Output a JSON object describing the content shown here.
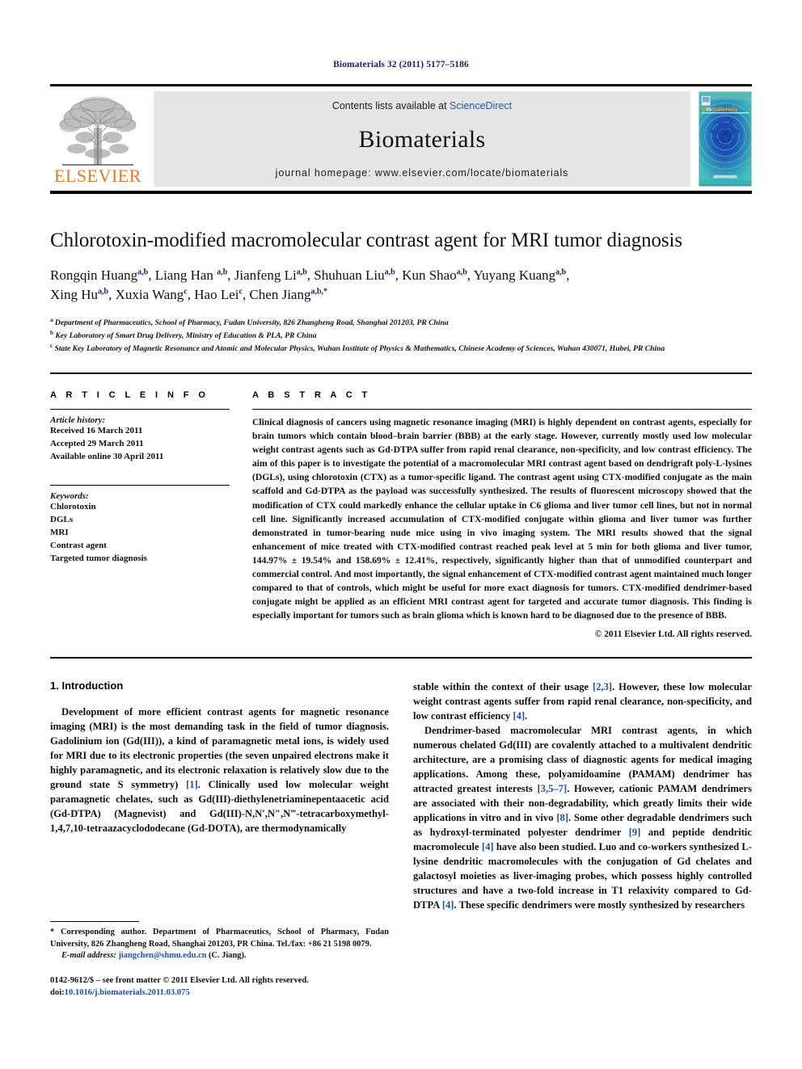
{
  "running_head": "Biomaterials 32 (2011) 5177–5186",
  "banner": {
    "publisher": "ELSEVIER",
    "contents_prefix": "Contents lists available at ",
    "contents_link": "ScienceDirect",
    "journal_name": "Biomaterials",
    "homepage": "journal homepage: www.elsevier.com/locate/biomaterials",
    "cover_title": "Biomaterials"
  },
  "article": {
    "title": "Chlorotoxin-modified macromolecular contrast agent for MRI tumor diagnosis",
    "authors_line1": "Rongqin Huang a,b, Liang Han a,b, Jianfeng Li a,b, Shuhuan Liu a,b, Kun Shao a,b, Yuyang Kuang a,b,",
    "authors_line2": "Xing Hu a,b, Xuxia Wang c, Hao Lei c, Chen Jiang a,b,*",
    "affiliations": [
      "Department of Pharmaceutics, School of Pharmacy, Fudan University, 826 Zhangheng Road, Shanghai 201203, PR China",
      "Key Laboratory of Smart Drug Delivery, Ministry of Education & PLA, PR China",
      "State Key Laboratory of Magnetic Resonance and Atomic and Molecular Physics, Wuhan Institute of Physics & Mathematics, Chinese Academy of Sciences, Wuhan 430071, Hubei, PR China"
    ]
  },
  "article_info": {
    "heading": "A R T I C L E   I N F O",
    "history_label": "Article history:",
    "history": [
      "Received 16 March 2011",
      "Accepted 29 March 2011",
      "Available online 30 April 2011"
    ],
    "keywords_label": "Keywords:",
    "keywords": [
      "Chlorotoxin",
      "DGLs",
      "MRI",
      "Contrast agent",
      "Targeted tumor diagnosis"
    ]
  },
  "abstract": {
    "heading": "A B S T R A C T",
    "text": "Clinical diagnosis of cancers using magnetic resonance imaging (MRI) is highly dependent on contrast agents, especially for brain tumors which contain blood–brain barrier (BBB) at the early stage. However, currently mostly used low molecular weight contrast agents such as Gd-DTPA suffer from rapid renal clearance, non-specificity, and low contrast efficiency. The aim of this paper is to investigate the potential of a macromolecular MRI contrast agent based on dendrigraft poly-L-lysines (DGLs), using chlorotoxin (CTX) as a tumor-specific ligand. The contrast agent using CTX-modified conjugate as the main scaffold and Gd-DTPA as the payload was successfully synthesized. The results of fluorescent microscopy showed that the modification of CTX could markedly enhance the cellular uptake in C6 glioma and liver tumor cell lines, but not in normal cell line. Significantly increased accumulation of CTX-modified conjugate within glioma and liver tumor was further demonstrated in tumor-bearing nude mice using in vivo imaging system. The MRI results showed that the signal enhancement of mice treated with CTX-modified contrast reached peak level at 5 min for both glioma and liver tumor, 144.97% ± 19.54% and 158.69% ± 12.41%, respectively, significantly higher than that of unmodified counterpart and commercial control. And most importantly, the signal enhancement of CTX-modified contrast agent maintained much longer compared to that of controls, which might be useful for more exact diagnosis for tumors. CTX-modified dendrimer-based conjugate might be applied as an efficient MRI contrast agent for targeted and accurate tumor diagnosis. This finding is especially important for tumors such as brain glioma which is known hard to be diagnosed due to the presence of BBB.",
    "copyright": "© 2011 Elsevier Ltd. All rights reserved."
  },
  "introduction": {
    "heading": "1.  Introduction",
    "para1_a": "Development of more efficient contrast agents for magnetic resonance imaging (MRI) is the most demanding task in the field of tumor diagnosis. Gadolinium ion (Gd(III)), a kind of paramagnetic metal ions, is widely used for MRI due to its electronic properties (the seven unpaired electrons make it highly paramagnetic, and its electronic relaxation is relatively slow due to the ground state S symmetry) ",
    "ref1": "[1]",
    "para1_b": ". Clinically used low molecular weight paramagnetic chelates, such as Gd(III)-diethylenetriaminepentaacetic acid (Gd-DTPA) (Magnevist) and Gd(III)-N,N′,N″,N‴-tetracarboxymethyl-1,4,7,10-tetraazacyclododecane (Gd-DOTA), are thermodynamically ",
    "para1_c": "stable within the context of their usage ",
    "ref23": "[2,3]",
    "para1_d": ". However, these low molecular weight contrast agents suffer from rapid renal clearance, non-specificity, and low contrast efficiency ",
    "ref4": "[4]",
    "para1_e": ".",
    "para2_a": "Dendrimer-based macromolecular MRI contrast agents, in which numerous chelated Gd(III) are covalently attached to a multivalent dendritic architecture, are a promising class of diagnostic agents for medical imaging applications. Among these, polyamidoamine (PAMAM) dendrimer has attracted greatest interests ",
    "ref357": "[3,5–7]",
    "para2_b": ". However, cationic PAMAM dendrimers are associated with their non-degradability, which greatly limits their wide applications in vitro and in vivo ",
    "ref8": "[8]",
    "para2_c": ". Some other degradable dendrimers such as hydroxyl-terminated polyester dendrimer ",
    "ref9": "[9]",
    "para2_d": " and peptide dendritic macromolecule ",
    "ref4b": "[4]",
    "para2_e": " have also been studied. Luo and co-workers synthesized L-lysine dendritic macromolecules with the conjugation of Gd chelates and galactosyl moieties as liver-imaging probes, which possess highly controlled structures and have a two-fold increase in T1 relaxivity compared to Gd-DTPA ",
    "ref4c": "[4]",
    "para2_f": ". These specific dendrimers were mostly synthesized by researchers"
  },
  "footnote": {
    "corresponding": "* Corresponding author. Department of Pharmaceutics, School of Pharmacy, Fudan University, 826 Zhangheng Road, Shanghai 201203, PR China. Tel./fax: +86 21 5198 0079.",
    "email_label": "E-mail address:",
    "email": "jiangchen@shmu.edu.cn",
    "email_suffix": "(C. Jiang).",
    "issn_line": "0142-9612/$ – see front matter © 2011 Elsevier Ltd. All rights reserved.",
    "doi_label": "doi:",
    "doi": "10.1016/j.biomaterials.2011.03.075"
  },
  "colors": {
    "elsevier_orange": "#E87722",
    "link_blue": "#2b55a8",
    "ref_blue": "#1d4f9e",
    "running_head_navy": "#1a2060",
    "banner_grey": "#e6e6e6",
    "cover_teal": "#2fa7a8",
    "cover_blue": "#1b3f9c"
  }
}
